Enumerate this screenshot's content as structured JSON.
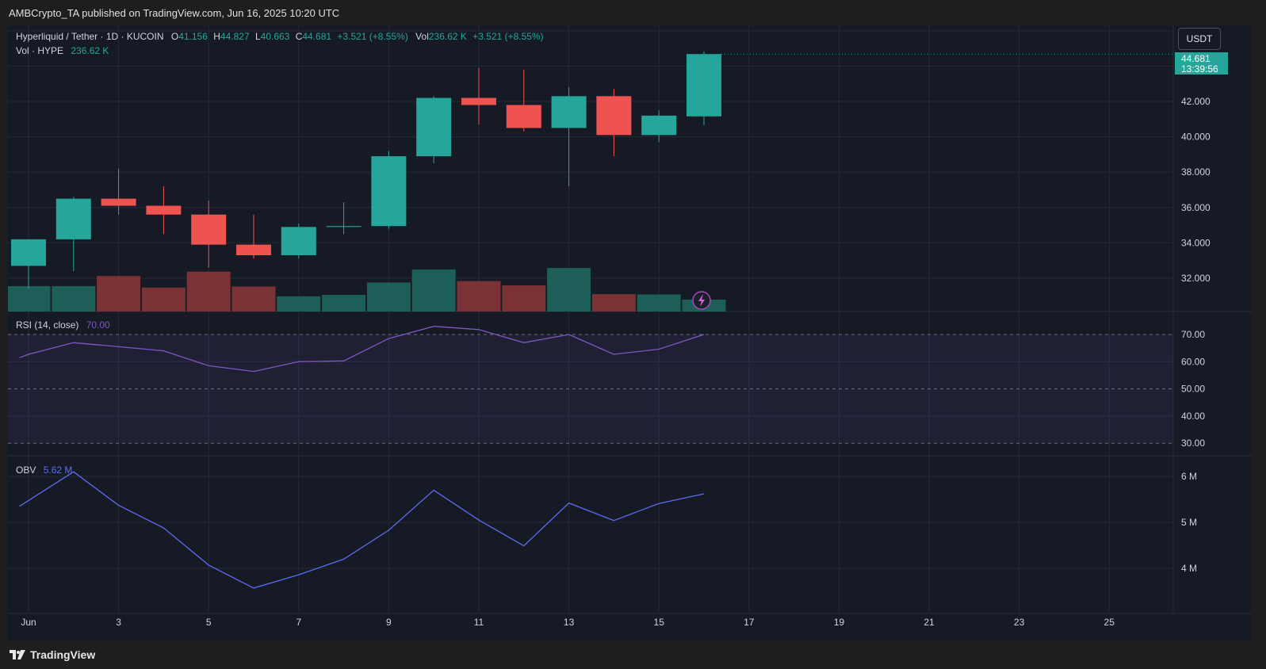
{
  "header": {
    "title": "AMBCrypto_TA published on TradingView.com, Jun 16, 2025 10:20 UTC"
  },
  "legend": {
    "symbol": "Hyperliquid / Tether · 1D · KUCOIN",
    "o_label": "O",
    "o_value": "41.156",
    "h_label": "H",
    "h_value": "44.827",
    "l_label": "L",
    "l_value": "40.663",
    "c_label": "C",
    "c_value": "44.681",
    "change": "+3.521 (+8.55%)",
    "vol_label": "Vol",
    "vol_value": "236.62 K",
    "vol_change": "+3.521 (+8.55%)",
    "vol_line_label": "Vol · HYPE",
    "vol_line_value": "236.62 K"
  },
  "rsi_legend": {
    "label": "RSI (14, close)",
    "value": "70.00"
  },
  "obv_legend": {
    "label": "OBV",
    "value": "5.62 M"
  },
  "currency_button": "USDT",
  "price_badge": {
    "price": "44.681",
    "countdown": "13:39:56"
  },
  "footer": {
    "brand": "TradingView"
  },
  "colors": {
    "up": "#26a69a",
    "down": "#ef5350",
    "up_volume": "#1e5e58",
    "down_volume": "#7a3235",
    "rsi_line": "#7e57c2",
    "obv_line": "#5b6cf2",
    "background": "#161a25",
    "grid": "#242938"
  },
  "x_axis": {
    "ticks": [
      {
        "day": 1,
        "label": "Jun"
      },
      {
        "day": 3,
        "label": "3"
      },
      {
        "day": 5,
        "label": "5"
      },
      {
        "day": 7,
        "label": "7"
      },
      {
        "day": 9,
        "label": "9"
      },
      {
        "day": 11,
        "label": "11"
      },
      {
        "day": 13,
        "label": "13"
      },
      {
        "day": 15,
        "label": "15"
      },
      {
        "day": 17,
        "label": "17"
      },
      {
        "day": 19,
        "label": "19"
      },
      {
        "day": 21,
        "label": "21"
      },
      {
        "day": 23,
        "label": "23"
      },
      {
        "day": 25,
        "label": "25"
      }
    ]
  },
  "chart_data": [
    {
      "type": "candlestick",
      "title": "Hyperliquid / Tether · 1D · KUCOIN",
      "x_unit": "day of June 2025",
      "price_axis": {
        "ticks": [
          {
            "value": 32,
            "label": "32.000"
          },
          {
            "value": 34,
            "label": "34.000"
          },
          {
            "value": 36,
            "label": "36.000"
          },
          {
            "value": 38,
            "label": "38.000"
          },
          {
            "value": 40,
            "label": "40.000"
          },
          {
            "value": 42,
            "label": "42.000"
          }
        ]
      },
      "candles": [
        {
          "day": 1,
          "open": 32.7,
          "high": 34.2,
          "low": 31.4,
          "close": 34.2
        },
        {
          "day": 2,
          "open": 34.2,
          "high": 36.6,
          "low": 32.4,
          "close": 36.5
        },
        {
          "day": 3,
          "open": 36.5,
          "high": 38.2,
          "low": 35.6,
          "close": 36.1
        },
        {
          "day": 4,
          "open": 36.1,
          "high": 37.2,
          "low": 34.5,
          "close": 35.6
        },
        {
          "day": 5,
          "open": 35.6,
          "high": 36.4,
          "low": 32.6,
          "close": 33.9
        },
        {
          "day": 6,
          "open": 33.9,
          "high": 35.6,
          "low": 33.1,
          "close": 33.3
        },
        {
          "day": 7,
          "open": 33.3,
          "high": 35.1,
          "low": 33.1,
          "close": 34.9
        },
        {
          "day": 8,
          "open": 34.9,
          "high": 36.3,
          "low": 34.5,
          "close": 34.95
        },
        {
          "day": 9,
          "open": 34.95,
          "high": 39.2,
          "low": 34.8,
          "close": 38.9
        },
        {
          "day": 10,
          "open": 38.9,
          "high": 42.3,
          "low": 38.5,
          "close": 42.2
        },
        {
          "day": 11,
          "open": 42.2,
          "high": 43.9,
          "low": 40.7,
          "close": 41.8
        },
        {
          "day": 12,
          "open": 41.8,
          "high": 43.8,
          "low": 40.3,
          "close": 40.5
        },
        {
          "day": 13,
          "open": 40.5,
          "high": 42.8,
          "low": 37.2,
          "close": 42.3
        },
        {
          "day": 14,
          "open": 42.3,
          "high": 42.7,
          "low": 38.9,
          "close": 40.1
        },
        {
          "day": 15,
          "open": 40.1,
          "high": 41.5,
          "low": 39.7,
          "close": 41.2
        },
        {
          "day": 16,
          "open": 41.156,
          "high": 44.827,
          "low": 40.663,
          "close": 44.681
        }
      ],
      "volume_series": {
        "name": "Vol · HYPE",
        "values": [
          {
            "day": 1,
            "value": 175,
            "direction": "up"
          },
          {
            "day": 2,
            "value": 175,
            "direction": "up"
          },
          {
            "day": 3,
            "value": 245,
            "direction": "down"
          },
          {
            "day": 4,
            "value": 165,
            "direction": "down"
          },
          {
            "day": 5,
            "value": 275,
            "direction": "down"
          },
          {
            "day": 6,
            "value": 172,
            "direction": "down"
          },
          {
            "day": 7,
            "value": 105,
            "direction": "up"
          },
          {
            "day": 8,
            "value": 115,
            "direction": "up"
          },
          {
            "day": 9,
            "value": 200,
            "direction": "up"
          },
          {
            "day": 10,
            "value": 290,
            "direction": "up"
          },
          {
            "day": 11,
            "value": 210,
            "direction": "down"
          },
          {
            "day": 12,
            "value": 180,
            "direction": "down"
          },
          {
            "day": 13,
            "value": 300,
            "direction": "up"
          },
          {
            "day": 14,
            "value": 120,
            "direction": "down"
          },
          {
            "day": 15,
            "value": 118,
            "direction": "up"
          },
          {
            "day": 16,
            "value": 82,
            "direction": "up"
          }
        ]
      }
    },
    {
      "type": "line",
      "title": "RSI (14, close)",
      "ylim": [
        28,
        75
      ],
      "y_ticks": [
        {
          "value": 30,
          "label": "30.00"
        },
        {
          "value": 40,
          "label": "40.00"
        },
        {
          "value": 50,
          "label": "50.00"
        },
        {
          "value": 60,
          "label": "60.00"
        },
        {
          "value": 70,
          "label": "70.00"
        }
      ],
      "band": [
        30,
        70
      ],
      "series": [
        {
          "values": [
            {
              "day": 0.8,
              "value": 61.5
            },
            {
              "day": 1,
              "value": 62.7
            },
            {
              "day": 2,
              "value": 67
            },
            {
              "day": 3,
              "value": 65.5
            },
            {
              "day": 4,
              "value": 64
            },
            {
              "day": 5,
              "value": 58.5
            },
            {
              "day": 6,
              "value": 56.4
            },
            {
              "day": 7,
              "value": 60
            },
            {
              "day": 8,
              "value": 60.3
            },
            {
              "day": 9,
              "value": 68.5
            },
            {
              "day": 10,
              "value": 73
            },
            {
              "day": 11,
              "value": 71.8
            },
            {
              "day": 12,
              "value": 67
            },
            {
              "day": 13,
              "value": 70
            },
            {
              "day": 14,
              "value": 62.7
            },
            {
              "day": 15,
              "value": 64.6
            },
            {
              "day": 16,
              "value": 70
            }
          ]
        }
      ]
    },
    {
      "type": "line",
      "title": "OBV",
      "ylim": [
        3.5,
        6.4
      ],
      "y_ticks": [
        {
          "value": 4,
          "label": "4 M"
        },
        {
          "value": 5,
          "label": "5 M"
        },
        {
          "value": 6,
          "label": "6 M"
        }
      ],
      "series": [
        {
          "values": [
            {
              "day": 0.8,
              "value": 5.35
            },
            {
              "day": 2,
              "value": 6.1
            },
            {
              "day": 3,
              "value": 5.37
            },
            {
              "day": 4,
              "value": 4.88
            },
            {
              "day": 5,
              "value": 4.07
            },
            {
              "day": 6,
              "value": 3.57
            },
            {
              "day": 7,
              "value": 3.86
            },
            {
              "day": 8,
              "value": 4.2
            },
            {
              "day": 9,
              "value": 4.83
            },
            {
              "day": 10,
              "value": 5.7
            },
            {
              "day": 11,
              "value": 5.05
            },
            {
              "day": 12,
              "value": 4.49
            },
            {
              "day": 13,
              "value": 5.42
            },
            {
              "day": 14,
              "value": 5.04
            },
            {
              "day": 15,
              "value": 5.41
            },
            {
              "day": 16,
              "value": 5.62
            }
          ]
        }
      ]
    }
  ]
}
